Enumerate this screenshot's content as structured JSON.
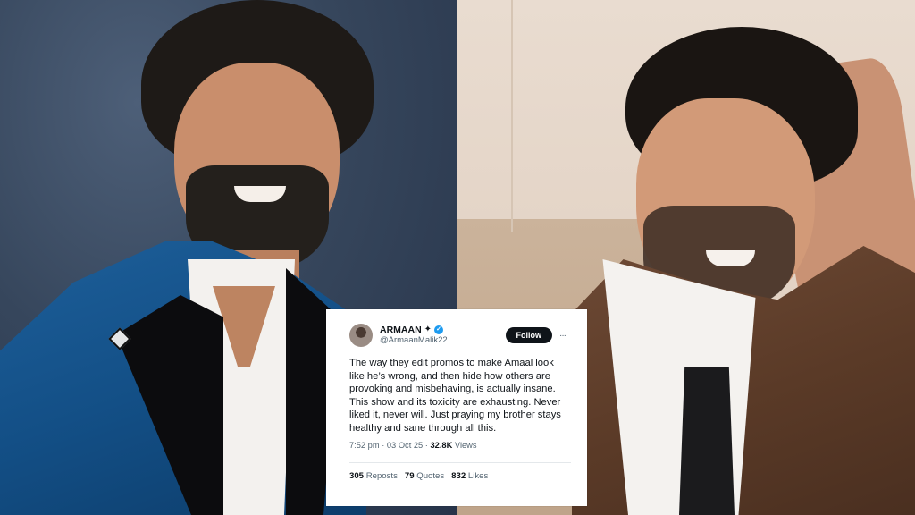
{
  "tweet": {
    "display_name": "ARMAAN",
    "sparkle_glyph": "✦",
    "verified_glyph": "✓",
    "handle": "@ArmaanMalik22",
    "follow_label": "Follow",
    "more_glyph": "···",
    "text": "The way they edit promos to make Amaal look like he’s wrong, and then hide how others are provoking and misbehaving, is actually insane. This show and its toxicity are exhausting. Never liked it, never will. Just praying my brother stays healthy and sane through all this.",
    "time": "7:52 pm",
    "separator": "·",
    "date": "03 Oct 25",
    "views_count": "32.8K",
    "views_label": "Views",
    "reposts_count": "305",
    "reposts_label": "Reposts",
    "quotes_count": "79",
    "quotes_label": "Quotes",
    "likes_count": "832",
    "likes_label": "Likes"
  },
  "colors": {
    "verified": "#1d9bf0",
    "follow_button": "#0f1419",
    "muted_text": "#536471"
  },
  "icons": {
    "verified": "verified-badge-icon",
    "more": "more-options-icon"
  }
}
